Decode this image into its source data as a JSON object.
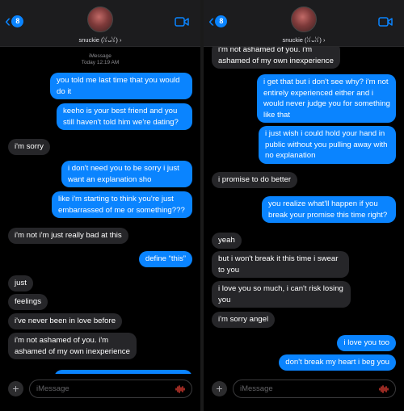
{
  "header": {
    "back_badge": "8",
    "contact_name": "snuckie (ꈍᴗꈍ) ›",
    "icons": [
      "chevron-left-icon",
      "video-camera-icon"
    ],
    "accent_color": "#0a84ff"
  },
  "left": {
    "service_label": "iMessage",
    "timestamp": "Today 12:19 AM",
    "messages": [
      {
        "dir": "sent",
        "text": "you told me last time that you would do it"
      },
      {
        "dir": "sent",
        "text": "keeho is your best friend and you still haven't told him we're dating?"
      },
      {
        "dir": "recv",
        "text": "i'm sorry"
      },
      {
        "dir": "sent",
        "text": "i don't need you to be sorry i just want an explanation sho"
      },
      {
        "dir": "sent",
        "text": "like i'm starting to think you're just embarrassed of me or something???"
      },
      {
        "dir": "recv",
        "text": "i'm not i'm just really bad at this"
      },
      {
        "dir": "sent",
        "text": "define \"this\""
      },
      {
        "dir": "recv",
        "text": "just"
      },
      {
        "dir": "recv",
        "text": "feelings"
      },
      {
        "dir": "recv",
        "text": "i've never been in love before"
      },
      {
        "dir": "recv",
        "text": "i'm not ashamed of you. i'm ashamed of my own inexperience"
      },
      {
        "dir": "sent",
        "text": "i get that but i don't see why? i'm not"
      }
    ]
  },
  "right": {
    "messages": [
      {
        "dir": "recv",
        "text": "i'm not ashamed of you. i'm ashamed of my own inexperience"
      },
      {
        "dir": "sent",
        "text": "i get that but i don't see why? i'm not entirely experienced either and i would never judge you for something like that"
      },
      {
        "dir": "sent",
        "text": "i just wish i could hold your hand in public without you pulling away with no explanation"
      },
      {
        "dir": "recv",
        "text": "i promise to do better"
      },
      {
        "dir": "sent",
        "text": "you realize what'll happen if you break your promise this time right?"
      },
      {
        "dir": "recv",
        "text": "yeah"
      },
      {
        "dir": "recv",
        "text": "but i won't break it this time i swear to you"
      },
      {
        "dir": "recv",
        "text": "i love you so much, i can't risk losing you"
      },
      {
        "dir": "recv",
        "text": "i'm sorry angel"
      },
      {
        "dir": "sent",
        "text": "i love you too"
      },
      {
        "dir": "sent",
        "text": "don't break my heart i beg you"
      }
    ]
  },
  "composer": {
    "placeholder": "iMessage",
    "plus_label": "+",
    "icons": [
      "plus-icon",
      "audio-waveform-icon"
    ]
  }
}
